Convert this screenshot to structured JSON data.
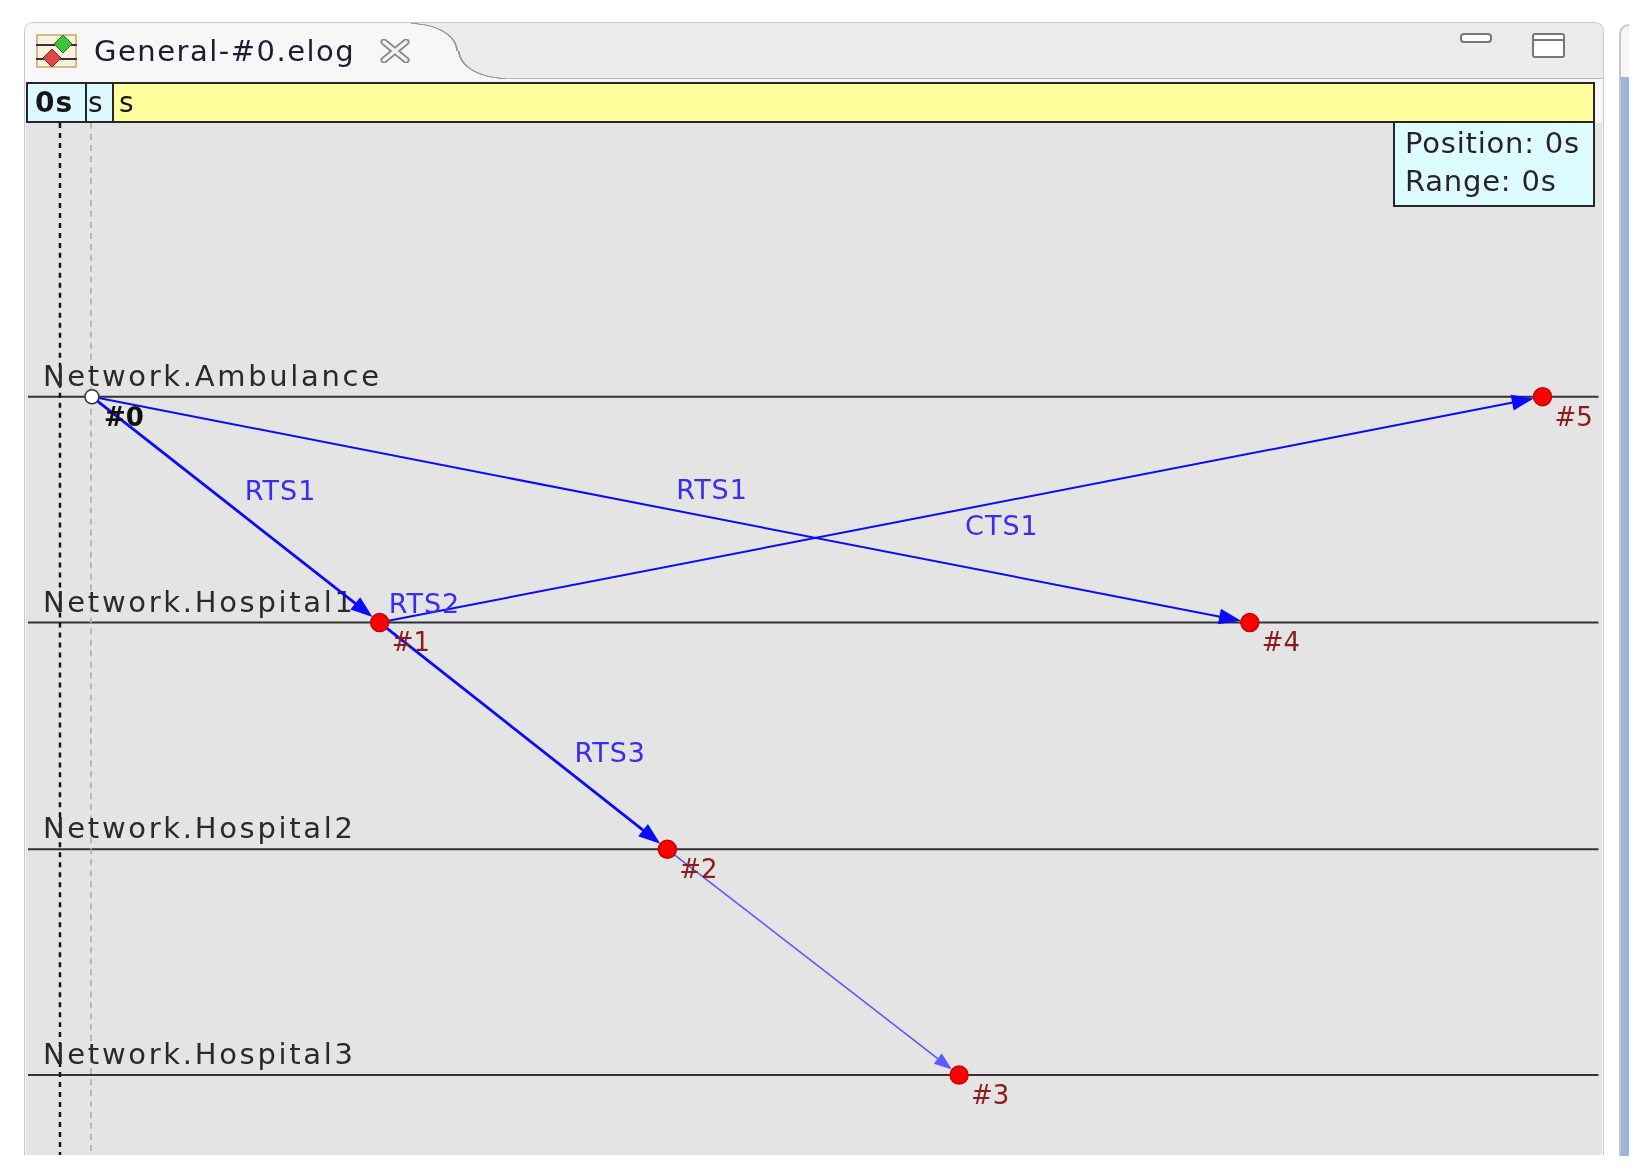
{
  "tabs": [
    {
      "title": "General-#0.elog",
      "selected": true
    }
  ],
  "timeline": {
    "cells": [
      {
        "text": "0s",
        "kind": "cursor"
      },
      {
        "text": "s",
        "kind": "marker"
      },
      {
        "text": "s",
        "kind": "ruler"
      }
    ]
  },
  "tooltip": {
    "position": "Position: 0s",
    "range": "Range: 0s"
  },
  "axes": [
    {
      "name": "Network.Ambulance"
    },
    {
      "name": "Network.Hospital1"
    },
    {
      "name": "Network.Hospital2"
    },
    {
      "name": "Network.Hospital3"
    }
  ],
  "events": [
    {
      "label": "#0",
      "kind": "initial"
    },
    {
      "label": "#1",
      "kind": "event"
    },
    {
      "label": "#2",
      "kind": "event"
    },
    {
      "label": "#3",
      "kind": "event"
    },
    {
      "label": "#4",
      "kind": "event"
    },
    {
      "label": "#5",
      "kind": "event"
    }
  ],
  "messages": [
    {
      "label": "RTS1"
    },
    {
      "label": "RTS1"
    },
    {
      "label": "CTS1"
    },
    {
      "label": "RTS2"
    },
    {
      "label": "RTS3"
    }
  ]
}
